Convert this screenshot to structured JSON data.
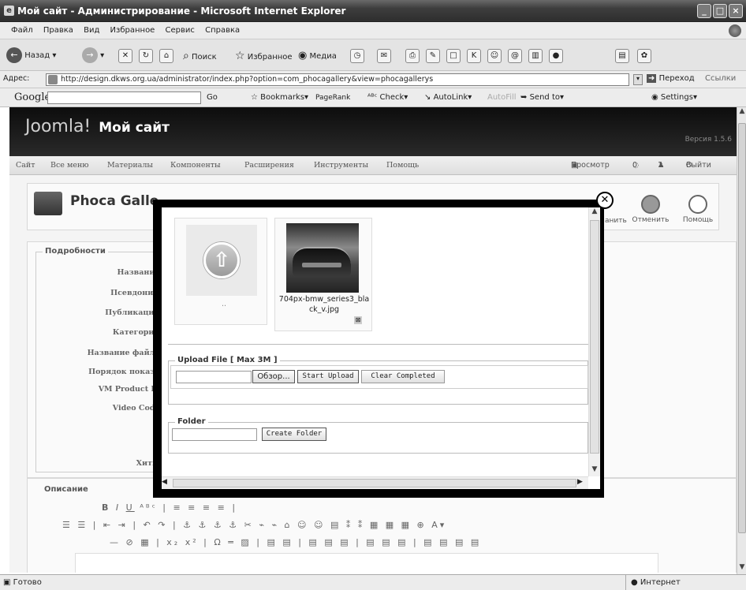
{
  "window": {
    "title": "Мой сайт - Администрирование - Microsoft Internet Explorer"
  },
  "menu": [
    "Файл",
    "Правка",
    "Вид",
    "Избранное",
    "Сервис",
    "Справка"
  ],
  "toolbar": {
    "back": "Назад",
    "search": "Поиск",
    "favorites": "Избранное",
    "media": "Медиа"
  },
  "address": {
    "label": "Адрес:",
    "url": "http://design.dkws.org.ua/administrator/index.php?option=com_phocagallery&view=phocagallerys",
    "go": "Переход",
    "links": "Ссылки"
  },
  "googlebar": {
    "logo": "Google",
    "go": "Go",
    "bookmarks": "Bookmarks",
    "pagerank": "PageRank",
    "check": "Check",
    "autolink": "AutoLink",
    "autofill": "AutoFill",
    "sendto": "Send to",
    "settings": "Settings"
  },
  "joomla": {
    "logo": "Joomla!",
    "site": "Мой сайт",
    "version": "Версия 1.5.6",
    "menu": [
      "Сайт",
      "Все меню",
      "Материалы",
      "Компоненты",
      "Расширения",
      "Инструменты",
      "Помощь"
    ],
    "status": {
      "preview": "Просмотр",
      "messages": "0",
      "users": "1",
      "logout": "Выйти"
    },
    "page_title": "Phoca Galle",
    "toolbar_partial": "анить",
    "cancel": "Отменить",
    "help": "Помощь"
  },
  "details": {
    "legend": "Подробности",
    "labels": [
      "Название:",
      "Псевдоним:",
      "Публикация:",
      "Категория:",
      "Название файла:",
      "Порядок показа:",
      "VM Product Id:",
      "Video Code:",
      "Хиты:"
    ]
  },
  "description": {
    "legend": "Описание"
  },
  "modal": {
    "up_caption": "..",
    "image_caption": "704px-bmw_series3_black_v.jpg",
    "upload_legend": "Upload File [ Max 3M ]",
    "browse": "Обзор...",
    "start_upload": "Start Upload",
    "clear_completed": "Clear Completed",
    "folder_legend": "Folder",
    "create_folder": "Create Folder"
  },
  "statusbar": {
    "left": "Готово",
    "right": "Интернет"
  }
}
